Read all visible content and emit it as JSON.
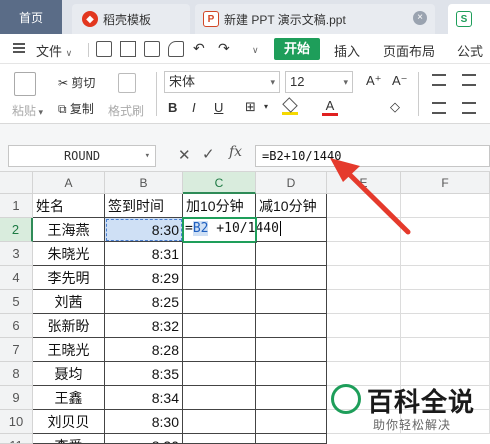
{
  "tabs": [
    {
      "label": "首页"
    },
    {
      "label": "稻壳模板"
    },
    {
      "label": "新建 PPT 演示文稿.ppt"
    },
    {
      "label": "S"
    }
  ],
  "menu": {
    "file_label": "文件",
    "start_label": "开始",
    "items": [
      "插入",
      "页面布局",
      "公式"
    ]
  },
  "ribbon": {
    "paste": "粘贴",
    "cut": "剪切",
    "copy": "复制",
    "format_painter": "格式刷",
    "font_name": "宋体",
    "font_size": "12",
    "bold": "B",
    "italic": "I",
    "underline": "U",
    "grow_font": "A⁺",
    "shrink_font": "A⁻"
  },
  "formula_bar": {
    "name_box": "ROUND",
    "cancel_icon": "✕",
    "confirm_icon": "✓",
    "fx_label": "fx",
    "formula": "=B2+10/1440"
  },
  "columns": [
    "A",
    "B",
    "C",
    "D",
    "E",
    "F"
  ],
  "rows": [
    {
      "num": "1",
      "a": "姓名",
      "b": "签到时间",
      "c": "加10分钟",
      "d": "减10分钟"
    },
    {
      "num": "2",
      "a": "王海燕",
      "b": "8:30",
      "c": "",
      "d": ""
    },
    {
      "num": "3",
      "a": "朱晓光",
      "b": "8:31",
      "c": "",
      "d": ""
    },
    {
      "num": "4",
      "a": "李先明",
      "b": "8:29",
      "c": "",
      "d": ""
    },
    {
      "num": "5",
      "a": "刘茜",
      "b": "8:25",
      "c": "",
      "d": ""
    },
    {
      "num": "6",
      "a": "张新盼",
      "b": "8:32",
      "c": "",
      "d": ""
    },
    {
      "num": "7",
      "a": "王晓光",
      "b": "8:28",
      "c": "",
      "d": ""
    },
    {
      "num": "8",
      "a": "聂均",
      "b": "8:35",
      "c": "",
      "d": ""
    },
    {
      "num": "9",
      "a": "王鑫",
      "b": "8:34",
      "c": "",
      "d": ""
    },
    {
      "num": "10",
      "a": "刘贝贝",
      "b": "8:30",
      "c": "",
      "d": ""
    },
    {
      "num": "11",
      "a": "李爱",
      "b": "8:30",
      "c": "",
      "d": ""
    }
  ],
  "editing_cell": {
    "prefix": "=",
    "ref": "B2",
    "suffix": " +10/1440"
  },
  "watermark": {
    "title": "百科全说",
    "subtitle": "助你轻松解决"
  },
  "colors": {
    "accent": "#1e9e5a",
    "arrow": "#e53a2c"
  }
}
